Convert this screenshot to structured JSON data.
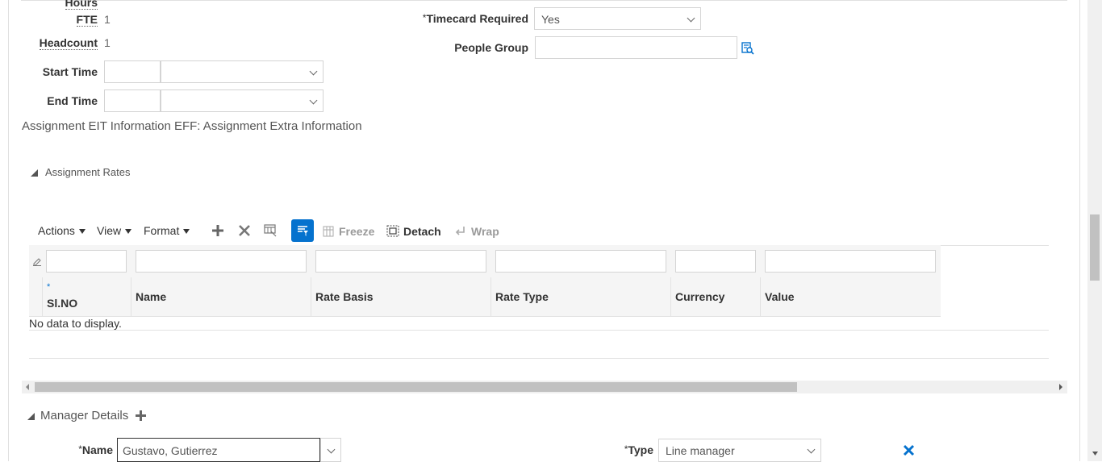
{
  "form": {
    "hours_label": "Hours",
    "fte_label": "FTE",
    "fte_value": "1",
    "headcount_label": "Headcount",
    "headcount_value": "1",
    "start_time_label": "Start Time",
    "end_time_label": "End Time",
    "timecard_label": "Timecard Required",
    "timecard_value": "Yes",
    "people_group_label": "People Group",
    "required_mark": "*"
  },
  "eit_text": "Assignment EIT Information EFF: Assignment Extra Information",
  "rates": {
    "section_title": "Assignment Rates",
    "toolbar": {
      "actions": "Actions",
      "view": "View",
      "format": "Format",
      "freeze": "Freeze",
      "detach": "Detach",
      "wrap": "Wrap"
    },
    "columns": [
      "Sl.NO",
      "Name",
      "Rate Basis",
      "Rate Type",
      "Currency",
      "Value"
    ],
    "empty_text": "No data to display."
  },
  "manager": {
    "section_title": "Manager Details",
    "name_label": "Name",
    "name_value": "Gustavo, Gutierrez",
    "type_label": "Type",
    "type_value": "Line manager"
  },
  "colors": {
    "accent": "#0572ce",
    "label": "#333333"
  }
}
